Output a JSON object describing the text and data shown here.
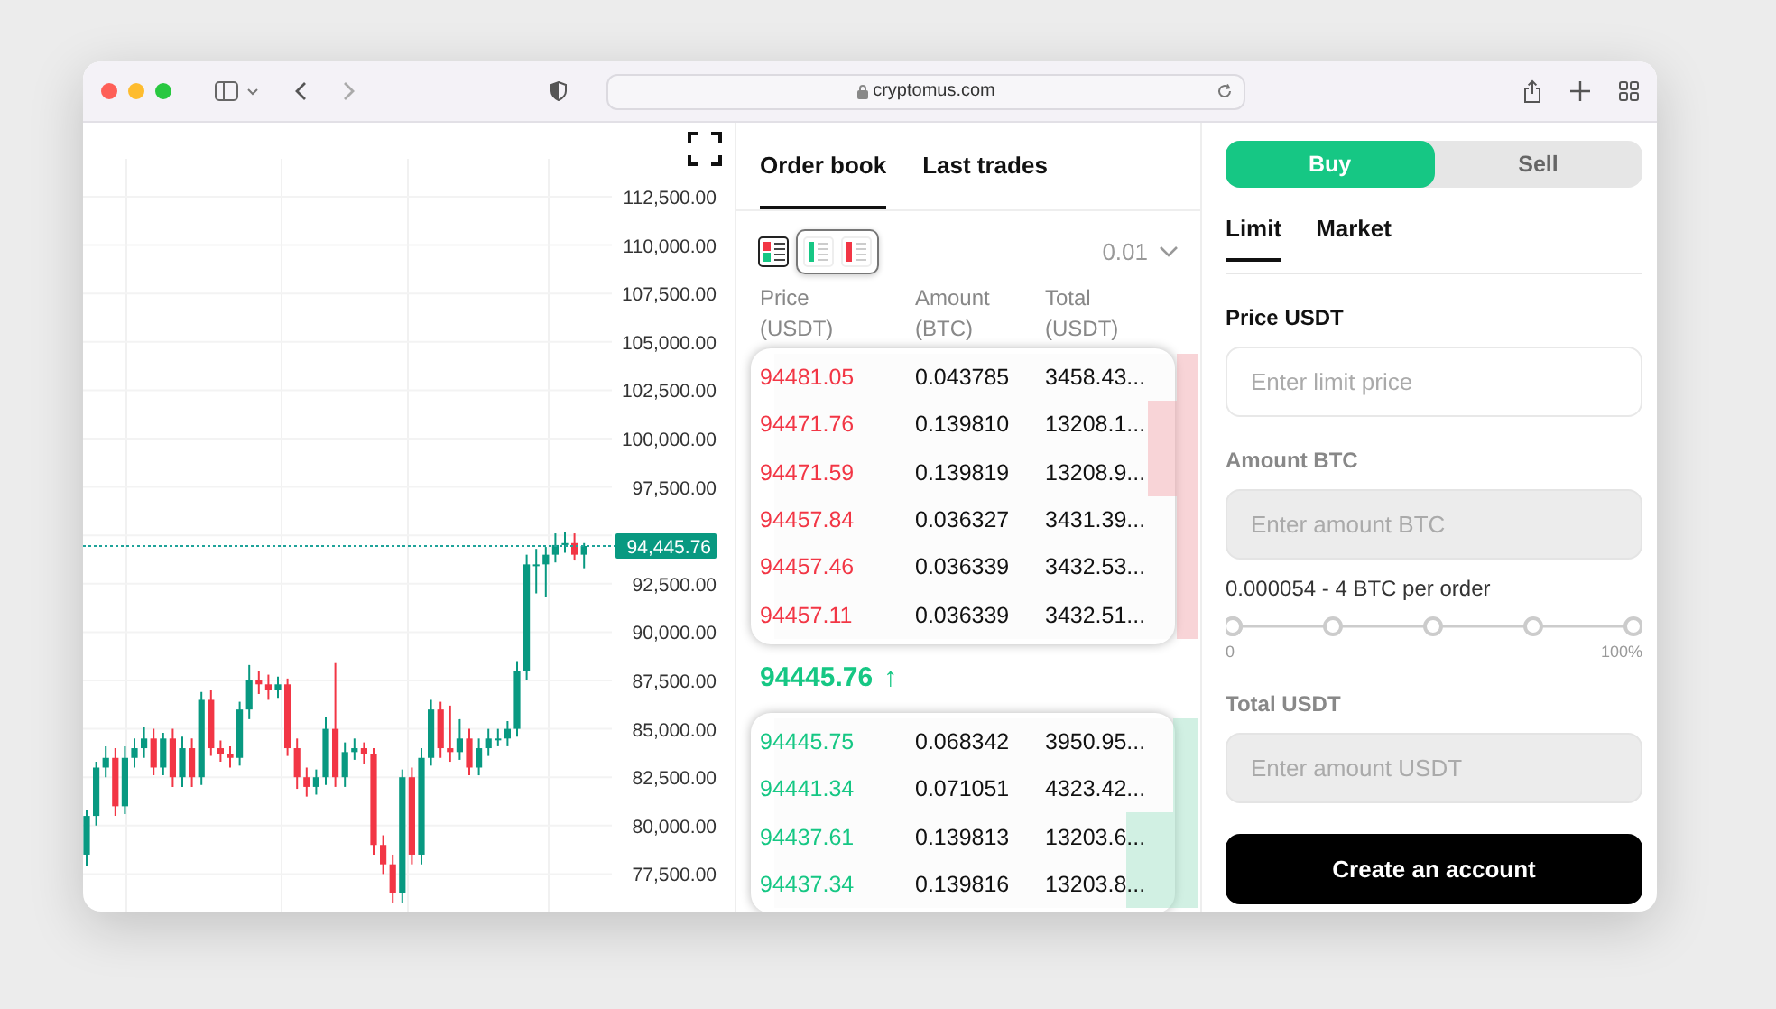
{
  "browser": {
    "address": "cryptomus.com"
  },
  "chart": {
    "chart_data": {
      "type": "candlestick",
      "ref_lines": [
        {
          "axis": "y",
          "value": 94445.76,
          "label": "94,445.76"
        }
      ],
      "ohlc": [
        [
          78500,
          80800,
          77900,
          80500
        ],
        [
          80500,
          83300,
          80000,
          83000
        ],
        [
          83000,
          84100,
          82500,
          83500
        ],
        [
          83500,
          84000,
          80500,
          81000
        ],
        [
          81000,
          84100,
          80600,
          83500
        ],
        [
          83500,
          84500,
          83000,
          84000
        ],
        [
          84000,
          85100,
          83500,
          84500
        ],
        [
          84500,
          85000,
          82600,
          83000
        ],
        [
          83000,
          84800,
          82600,
          84500
        ],
        [
          84500,
          85000,
          82000,
          82500
        ],
        [
          82500,
          84600,
          82000,
          84000
        ],
        [
          84000,
          84500,
          82000,
          82500
        ],
        [
          82500,
          86900,
          82100,
          86500
        ],
        [
          86500,
          87000,
          83600,
          84000
        ],
        [
          84000,
          84400,
          83300,
          83700
        ],
        [
          83700,
          84100,
          83000,
          83500
        ],
        [
          83500,
          86400,
          83100,
          86000
        ],
        [
          86000,
          88300,
          85500,
          87500
        ],
        [
          87500,
          88000,
          86800,
          87300
        ],
        [
          87300,
          87800,
          86500,
          87000
        ],
        [
          87000,
          87700,
          86600,
          87300
        ],
        [
          87300,
          87600,
          83600,
          84000
        ],
        [
          84000,
          84500,
          81900,
          82500
        ],
        [
          82500,
          83000,
          81500,
          82000
        ],
        [
          82000,
          82900,
          81600,
          82500
        ],
        [
          82500,
          85600,
          82100,
          85000
        ],
        [
          85000,
          88400,
          82000,
          82500
        ],
        [
          82500,
          84300,
          82000,
          83800
        ],
        [
          83800,
          84500,
          83400,
          84000
        ],
        [
          84000,
          84300,
          83200,
          83700
        ],
        [
          83700,
          84000,
          78500,
          79000
        ],
        [
          79000,
          79500,
          77500,
          78000
        ],
        [
          78000,
          78500,
          76000,
          76500
        ],
        [
          76500,
          82900,
          76000,
          82500
        ],
        [
          82500,
          83000,
          78000,
          78500
        ],
        [
          78500,
          84000,
          78000,
          83500
        ],
        [
          83500,
          86500,
          83100,
          86000
        ],
        [
          86000,
          86400,
          83500,
          84000
        ],
        [
          84000,
          86200,
          83300,
          83800
        ],
        [
          83800,
          85500,
          83400,
          84500
        ],
        [
          84500,
          85000,
          82600,
          83000
        ],
        [
          83000,
          84500,
          82600,
          84000
        ],
        [
          84000,
          85000,
          83600,
          84500
        ],
        [
          84500,
          85000,
          84100,
          84500
        ],
        [
          84500,
          85400,
          84100,
          85000
        ],
        [
          85000,
          88500,
          84600,
          88000
        ],
        [
          88000,
          94000,
          87500,
          93500
        ],
        [
          93500,
          94300,
          92000,
          93500
        ],
        [
          93500,
          94400,
          91800,
          94000
        ],
        [
          94000,
          95100,
          93600,
          94500
        ],
        [
          94500,
          95200,
          94100,
          94600
        ],
        [
          94600,
          95100,
          93700,
          94000
        ],
        [
          94000,
          94600,
          93300,
          94450
        ]
      ],
      "ylim": [
        77500,
        112500
      ],
      "yticks": [
        {
          "value": 112500,
          "label": "112,500.00"
        },
        {
          "value": 110000,
          "label": "110,000.00"
        },
        {
          "value": 107500,
          "label": "107,500.00"
        },
        {
          "value": 105000,
          "label": "105,000.00"
        },
        {
          "value": 102500,
          "label": "102,500.00"
        },
        {
          "value": 100000,
          "label": "100,000.00"
        },
        {
          "value": 97500,
          "label": "97,500.00"
        },
        {
          "value": 92500,
          "label": "92,500.00"
        },
        {
          "value": 90000,
          "label": "90,000.00"
        },
        {
          "value": 87500,
          "label": "87,500.00"
        },
        {
          "value": 85000,
          "label": "85,000.00"
        },
        {
          "value": 82500,
          "label": "82,500.00"
        },
        {
          "value": 80000,
          "label": "80,000.00"
        },
        {
          "value": 77500,
          "label": "77,500.00"
        }
      ]
    }
  },
  "order_book": {
    "tabs": [
      {
        "label": "Order book",
        "selected": true
      },
      {
        "label": "Last trades",
        "selected": false
      }
    ],
    "view_modes": [
      {
        "kind": "both",
        "selected": true
      },
      {
        "kind": "bids",
        "selected": false
      },
      {
        "kind": "asks",
        "selected": false
      }
    ],
    "precision": "0.01",
    "columns": [
      "Price (USDT)",
      "Amount (BTC)",
      "Total (USDT)"
    ],
    "asks": [
      {
        "price": "94481.05",
        "amount": "0.043785",
        "total": "3458.43...",
        "level": 0.05
      },
      {
        "price": "94471.76",
        "amount": "0.139810",
        "total": "13208.1...",
        "level": 0.12
      },
      {
        "price": "94471.59",
        "amount": "0.139819",
        "total": "13208.9...",
        "level": 0.12
      },
      {
        "price": "94457.84",
        "amount": "0.036327",
        "total": "3431.39...",
        "level": 0.05
      },
      {
        "price": "94457.46",
        "amount": "0.036339",
        "total": "3432.53...",
        "level": 0.05
      },
      {
        "price": "94457.11",
        "amount": "0.036339",
        "total": "3432.51...",
        "level": 0.05
      }
    ],
    "last_price": "94445.76",
    "last_price_arrow": "↑",
    "bids": [
      {
        "price": "94445.75",
        "amount": "0.068342",
        "total": "3950.95...",
        "level": 0.06
      },
      {
        "price": "94441.34",
        "amount": "0.071051",
        "total": "4323.42...",
        "level": 0.06
      },
      {
        "price": "94437.61",
        "amount": "0.139813",
        "total": "13203.6...",
        "level": 0.17
      },
      {
        "price": "94437.34",
        "amount": "0.139816",
        "total": "13203.8...",
        "level": 0.17
      }
    ]
  },
  "order_form": {
    "sides": [
      {
        "label": "Buy",
        "selected": true
      },
      {
        "label": "Sell",
        "selected": false
      }
    ],
    "order_types": [
      {
        "label": "Limit",
        "selected": true
      },
      {
        "label": "Market",
        "selected": false
      }
    ],
    "fields": [
      {
        "label": "Price USDT",
        "placeholder": "Enter limit price",
        "disabled": false
      },
      {
        "label": "Amount BTC",
        "placeholder": "Enter amount BTC",
        "disabled": true
      },
      {
        "label": "Total USDT",
        "placeholder": "Enter amount USDT",
        "disabled": true
      }
    ],
    "order_limits": "0.000054 - 4 BTC per order",
    "slider": {
      "level": 0,
      "min_label": "0",
      "max_label": "100%"
    },
    "submit": "Create an account"
  }
}
